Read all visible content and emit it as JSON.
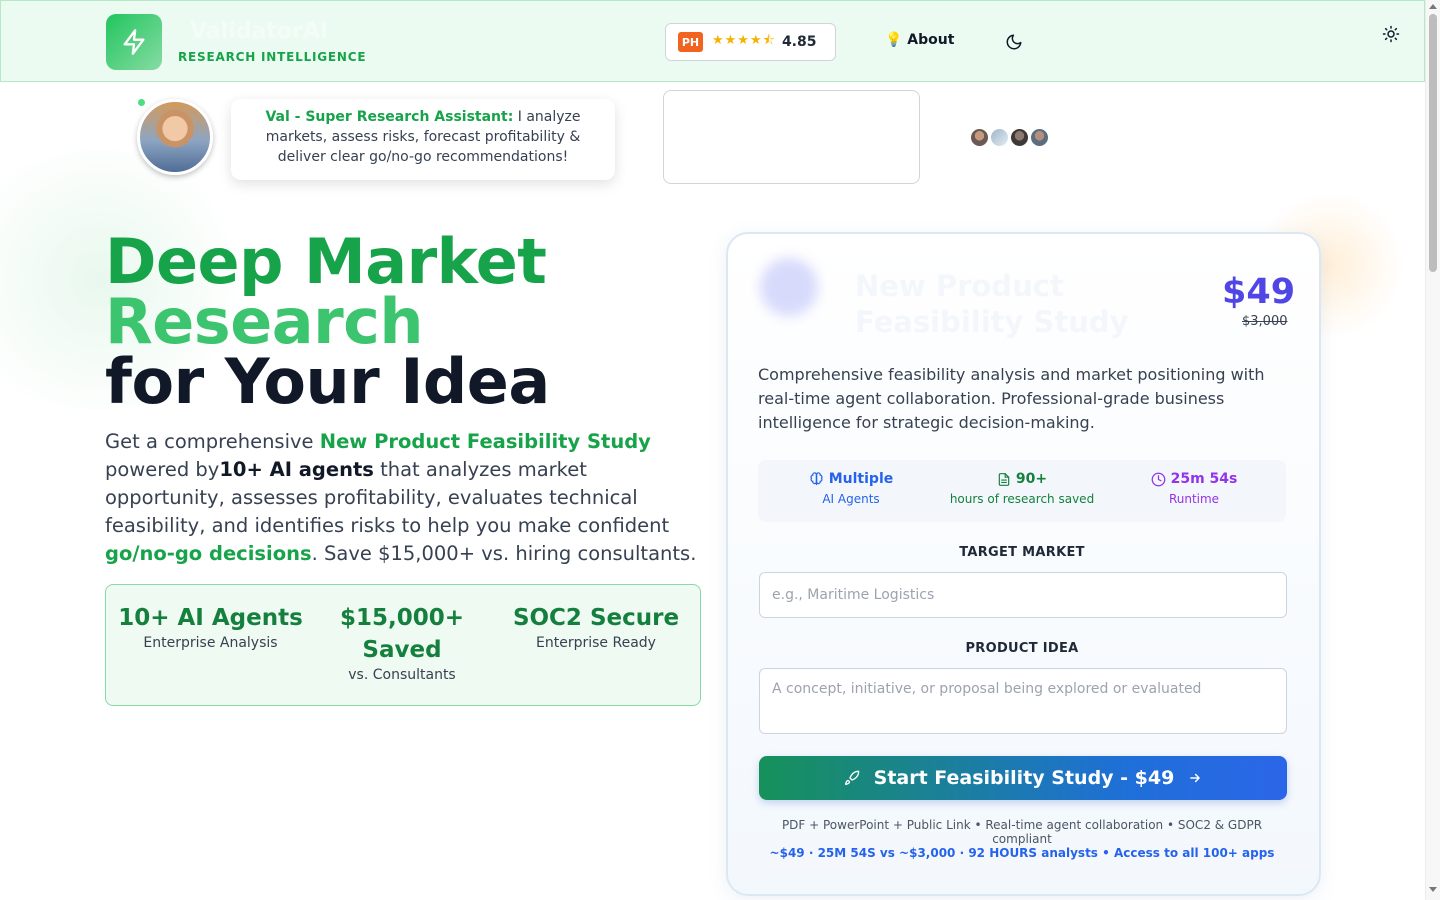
{
  "header": {
    "brand_name": "ValidatorAI",
    "brand_tagline": "RESEARCH INTELLIGENCE",
    "producthunt_badge": "PH",
    "producthunt_stars": "★★★★⯪",
    "producthunt_rating": "4.85",
    "about_label": "💡 About"
  },
  "assistant": {
    "name": "Val - Super Research Assistant:",
    "message": "I analyze markets, assess risks, forecast profitability & deliver clear go/no-go recommendations!"
  },
  "hero": {
    "title_line1": "Deep Market",
    "title_line2": "Research",
    "title_line3": "for Your Idea",
    "desc_part1": "Get a comprehensive ",
    "desc_highlight1": "New Product Feasibility Study",
    "desc_part2": " powered by",
    "desc_bold": "10+ AI agents",
    "desc_part3": " that analyzes market opportunity, assesses profitability, evaluates technical feasibility, and identifies risks to help you make confident ",
    "desc_highlight2": "go/no-go decisions",
    "desc_part4": ". Save $15,000+ vs. hiring consultants."
  },
  "stats": [
    {
      "value": "10+ AI Agents",
      "label": "Enterprise Analysis"
    },
    {
      "value": "$15,000+ Saved",
      "label": "vs. Consultants"
    },
    {
      "value": "SOC2 Secure",
      "label": "Enterprise Ready"
    }
  ],
  "card": {
    "title": "New Product Feasibility Study",
    "price": "$49",
    "old_price": "$3,000",
    "description": "Comprehensive feasibility analysis and market positioning with real-time agent collaboration. Professional-grade business intelligence for strategic decision-making.",
    "metrics": [
      {
        "value": "Multiple",
        "label": "AI Agents",
        "icon": "brain-icon",
        "color": "#2563eb"
      },
      {
        "value": "90+",
        "label": "hours of research saved",
        "icon": "document-icon",
        "color": "#15803d"
      },
      {
        "value": "25m 54s",
        "label": "Runtime",
        "icon": "clock-icon",
        "color": "#9333ea"
      }
    ],
    "target_market_label": "TARGET MARKET",
    "target_market_placeholder": "e.g., Maritime Logistics",
    "target_market_value": "",
    "product_idea_label": "PRODUCT IDEA",
    "product_idea_placeholder": "A concept, initiative, or proposal being explored or evaluated",
    "product_idea_value": "",
    "start_button_label": "Start Feasibility Study - $49",
    "fine_print": "PDF + PowerPoint + Public Link • Real-time agent collaboration • SOC2 & GDPR compliant",
    "comparison_line": "~$49 · 25M 54S vs ~$3,000 · 92 HOURS analysts • Access to all 100+ apps"
  },
  "colors": {
    "brand_green": "#16a34a",
    "accent_indigo": "#4f46e5",
    "accent_blue": "#2563eb",
    "producthunt_orange": "#f2631f"
  }
}
